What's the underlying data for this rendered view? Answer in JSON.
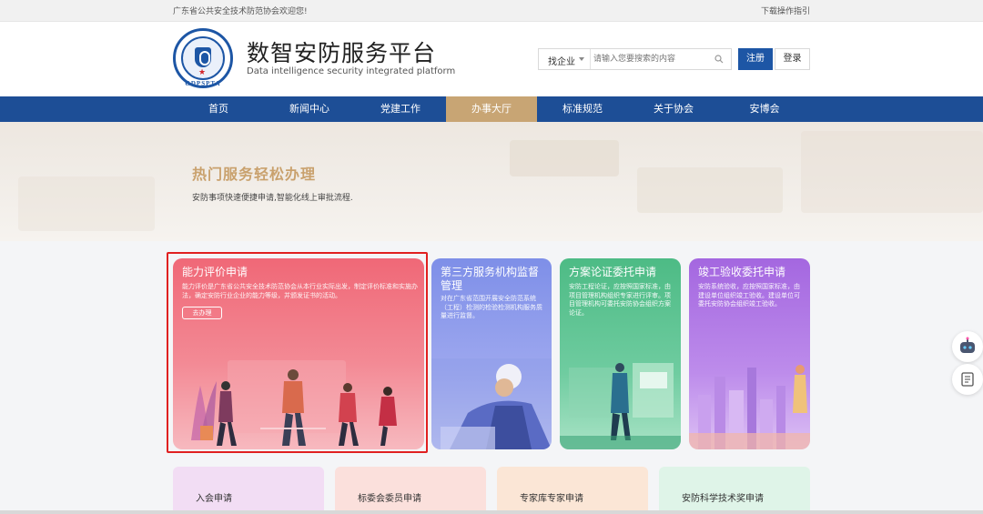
{
  "topbar": {
    "welcome": "广东省公共安全技术防范协会欢迎您!",
    "guide": "下载操作指引"
  },
  "header": {
    "logo_text": "GDPSPTA",
    "title": "数智安防服务平台",
    "subtitle": "Data intelligence security integrated platform",
    "search_select": "找企业",
    "search_placeholder": "请输入您要搜索的内容",
    "register": "注册",
    "login": "登录"
  },
  "nav": {
    "items": [
      {
        "label": "首页"
      },
      {
        "label": "新闻中心"
      },
      {
        "label": "党建工作"
      },
      {
        "label": "办事大厅"
      },
      {
        "label": "标准规范"
      },
      {
        "label": "关于协会"
      },
      {
        "label": "安博会"
      }
    ],
    "active": "办事大厅"
  },
  "hero": {
    "title": "热门服务轻松办理",
    "subtitle": "安防事项快速便捷申请,智能化线上审批流程."
  },
  "cards": [
    {
      "title": "能力评价申请",
      "desc": "能力评价是广东省公共安全技术防范协会从本行业实际出发，制定评价标准和实施办法，确定安防行业企业的能力等级，并颁发证书的活动。",
      "button": "去办理"
    },
    {
      "title": "第三方服务机构监督管理",
      "desc": "对在广东省范围开展安全防范系统（工程）检测的检验检测机构服务质量进行监督。"
    },
    {
      "title": "方案论证委托申请",
      "desc": "安防工程论证，应按照国家标准，由项目管理机构组织专家进行评审。项目管理机构可委托安防协会组织方案论证。"
    },
    {
      "title": "竣工验收委托申请",
      "desc": "安防系统验收，应按照国家标准，由建设单位组织竣工验收。建设单位可委托安防协会组织竣工验收。"
    }
  ],
  "sub_cards": [
    {
      "label": "入会申请"
    },
    {
      "label": "标委会委员申请"
    },
    {
      "label": "专家库专家申请"
    },
    {
      "label": "安防科学技术奖申请"
    }
  ],
  "colors": {
    "brand_blue": "#1d4e96",
    "nav_active": "#c8a574",
    "hero_title": "#c9a16d",
    "highlight": "#e02020"
  }
}
